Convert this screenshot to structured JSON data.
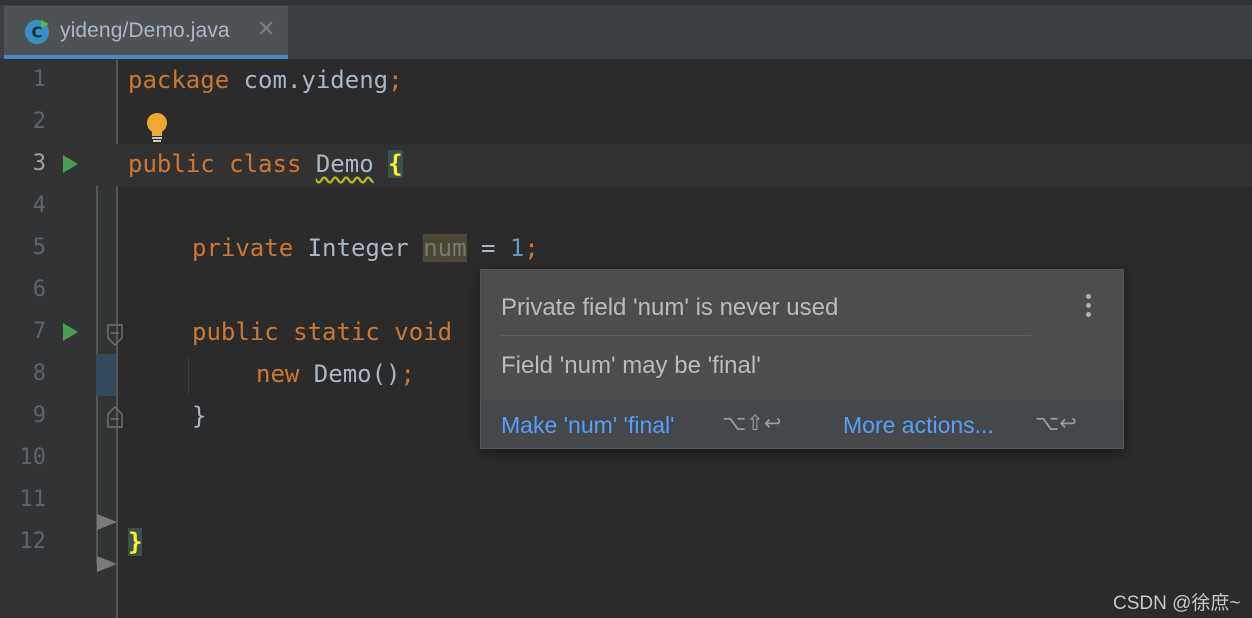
{
  "tab": {
    "label": "yideng/Demo.java",
    "close_glyph": "✕",
    "icon": "java-class-icon"
  },
  "editor": {
    "lines": [
      {
        "number": "1"
      },
      {
        "number": "2"
      },
      {
        "number": "3"
      },
      {
        "number": "4"
      },
      {
        "number": "5"
      },
      {
        "number": "6"
      },
      {
        "number": "7"
      },
      {
        "number": "8"
      },
      {
        "number": "9"
      },
      {
        "number": "10"
      },
      {
        "number": "11"
      },
      {
        "number": "12"
      }
    ],
    "code": {
      "l1_kw": "package",
      "l1_rest": " com.yideng",
      "l1_semi": ";",
      "l3_kw": "public class",
      "l3_name": "Demo",
      "l3_brace": "{",
      "l5_kw": "private",
      "l5_type": " Integer ",
      "l5_field": "num",
      "l5_eq": " = ",
      "l5_num": "1",
      "l5_semi": ";",
      "l7_kw": "public static void",
      "l8_kw": "new",
      "l8_rest": " Demo()",
      "l8_semi": ";",
      "l9_brace": "}",
      "l12_brace": "}"
    },
    "colors": {
      "keyword": "#cc7832",
      "number": "#6897bb",
      "text": "#a9b7c6",
      "run": "#499c54"
    }
  },
  "popup": {
    "message1": "Private field 'num' is never used",
    "message2": "Field 'num' may be 'final'",
    "action1_label": "Make 'num' 'final'",
    "action1_shortcut": "⌥⇧↩",
    "action2_label": "More actions...",
    "action2_shortcut": "⌥↩",
    "link_color": "#589df6"
  },
  "watermark": "CSDN @徐庶~"
}
